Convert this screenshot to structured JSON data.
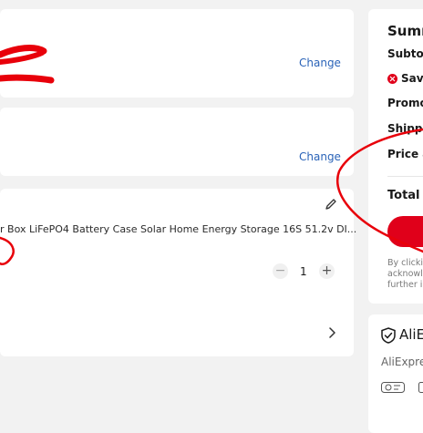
{
  "shipping_address": {
    "change_label": "Change"
  },
  "payment_method": {
    "change_label": "Change"
  },
  "product": {
    "title": "r Box LiFePO4 Battery Case Solar Home Energy Storage 16S 51.2v DI...",
    "quantity": "1",
    "minus": "−",
    "plus": "+"
  },
  "summary": {
    "title": "Summ",
    "subtotal_label": "Subtota",
    "savings_label": "Save",
    "promo_label": "Promo c",
    "shipping_label": "Shippi",
    "price_adjust_label": "Price ad",
    "total_label": "Total",
    "disclaimer_lines": [
      "By clickin",
      "acknowle",
      "further in"
    ]
  },
  "buyer_protection": {
    "title": "AliEx",
    "subtitle": "AliExpres"
  },
  "colors": {
    "background": "#f2f2f2",
    "card": "#ffffff",
    "link": "#2a63b8",
    "accent_red": "#e0001a",
    "annotation_red": "#e8000a"
  },
  "icons": [
    "edit-icon",
    "chevron-right-icon",
    "minus-icon",
    "plus-icon",
    "savings-icon",
    "shield-check-icon",
    "payment-badge-icon"
  ]
}
